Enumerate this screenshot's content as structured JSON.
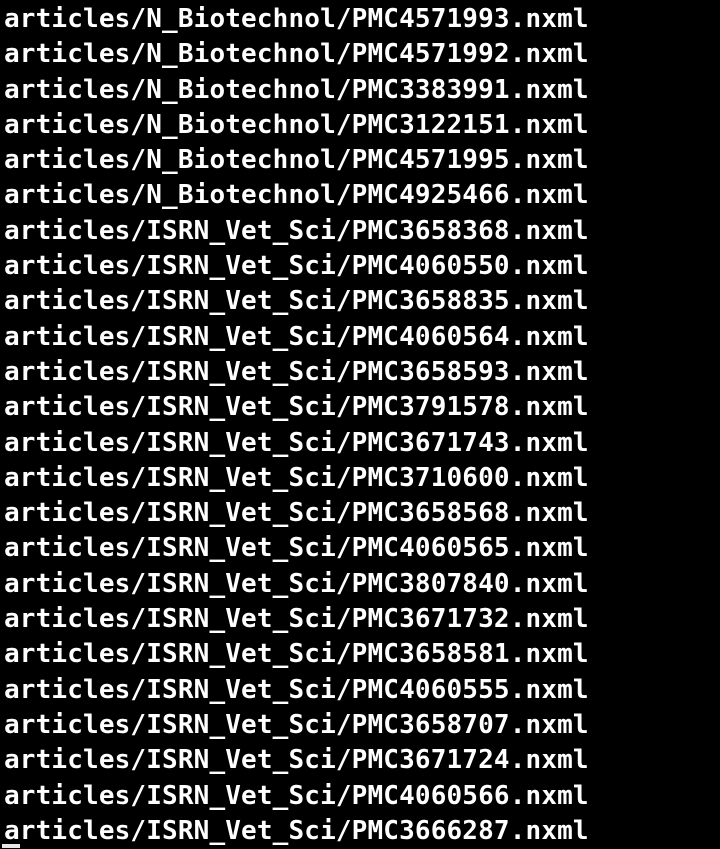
{
  "terminal": {
    "lines": [
      "articles/N_Biotechnol/PMC4571993.nxml",
      "articles/N_Biotechnol/PMC4571992.nxml",
      "articles/N_Biotechnol/PMC3383991.nxml",
      "articles/N_Biotechnol/PMC3122151.nxml",
      "articles/N_Biotechnol/PMC4571995.nxml",
      "articles/N_Biotechnol/PMC4925466.nxml",
      "articles/ISRN_Vet_Sci/PMC3658368.nxml",
      "articles/ISRN_Vet_Sci/PMC4060550.nxml",
      "articles/ISRN_Vet_Sci/PMC3658835.nxml",
      "articles/ISRN_Vet_Sci/PMC4060564.nxml",
      "articles/ISRN_Vet_Sci/PMC3658593.nxml",
      "articles/ISRN_Vet_Sci/PMC3791578.nxml",
      "articles/ISRN_Vet_Sci/PMC3671743.nxml",
      "articles/ISRN_Vet_Sci/PMC3710600.nxml",
      "articles/ISRN_Vet_Sci/PMC3658568.nxml",
      "articles/ISRN_Vet_Sci/PMC4060565.nxml",
      "articles/ISRN_Vet_Sci/PMC3807840.nxml",
      "articles/ISRN_Vet_Sci/PMC3671732.nxml",
      "articles/ISRN_Vet_Sci/PMC3658581.nxml",
      "articles/ISRN_Vet_Sci/PMC4060555.nxml",
      "articles/ISRN_Vet_Sci/PMC3658707.nxml",
      "articles/ISRN_Vet_Sci/PMC3671724.nxml",
      "articles/ISRN_Vet_Sci/PMC4060566.nxml",
      "articles/ISRN_Vet_Sci/PMC3666287.nxml"
    ]
  },
  "colors": {
    "background": "#000000",
    "text": "#ffffff",
    "cursor": "#e8e8e8"
  }
}
